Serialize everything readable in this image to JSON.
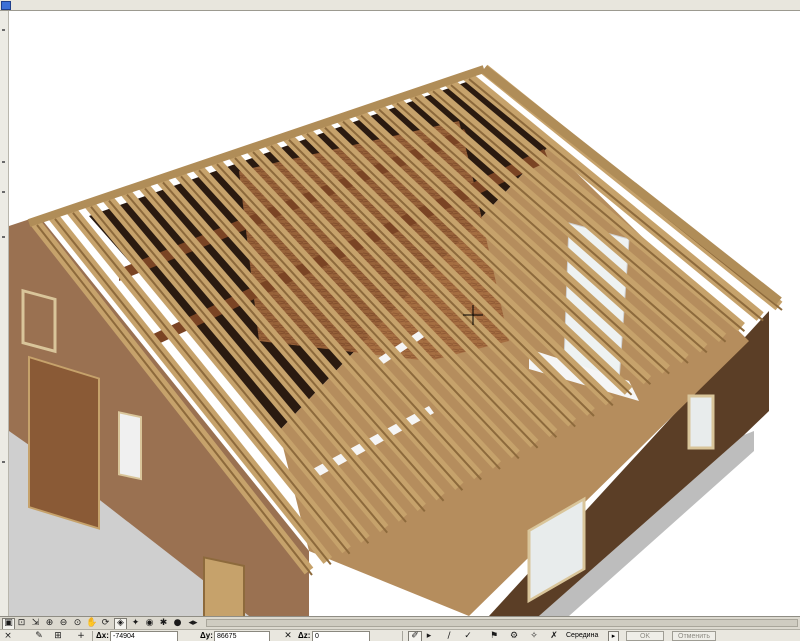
{
  "colors": {
    "sky": "#ffffff",
    "wall_light": "#9a7151",
    "wall_dark": "#5b3e26",
    "rafter": "#c6a26b",
    "rafter_edge": "#8d6a3c",
    "attic_floor": "#b58d5d",
    "interior_dark": "#2a1a10",
    "beam": "#7a4424",
    "foundation": "#d8d8d8",
    "toolbar_bg": "#dcd9cf"
  },
  "scene": {
    "view": "3D",
    "subject": "roof-rafters-framing",
    "cursor": "crosshair"
  },
  "toolbar": {
    "row1_icons": [
      "cube-icon",
      "zoom-window-icon",
      "zoom-fit-icon",
      "zoom-in-icon",
      "zoom-out-icon",
      "zoom-back-icon",
      "pan-icon",
      "orbit-icon",
      "walk-icon",
      "explore-icon",
      "camera-icon",
      "gear-icon"
    ]
  },
  "statusbar": {
    "dx_label": "Δx:",
    "dx_value": "-74904",
    "dy_label": "Δy:",
    "dy_value": "86675",
    "dz_label": "Δz:",
    "dz_value": "0",
    "snap_value": "Середина",
    "ok_label": "OK",
    "cancel_label": "Отменить"
  }
}
